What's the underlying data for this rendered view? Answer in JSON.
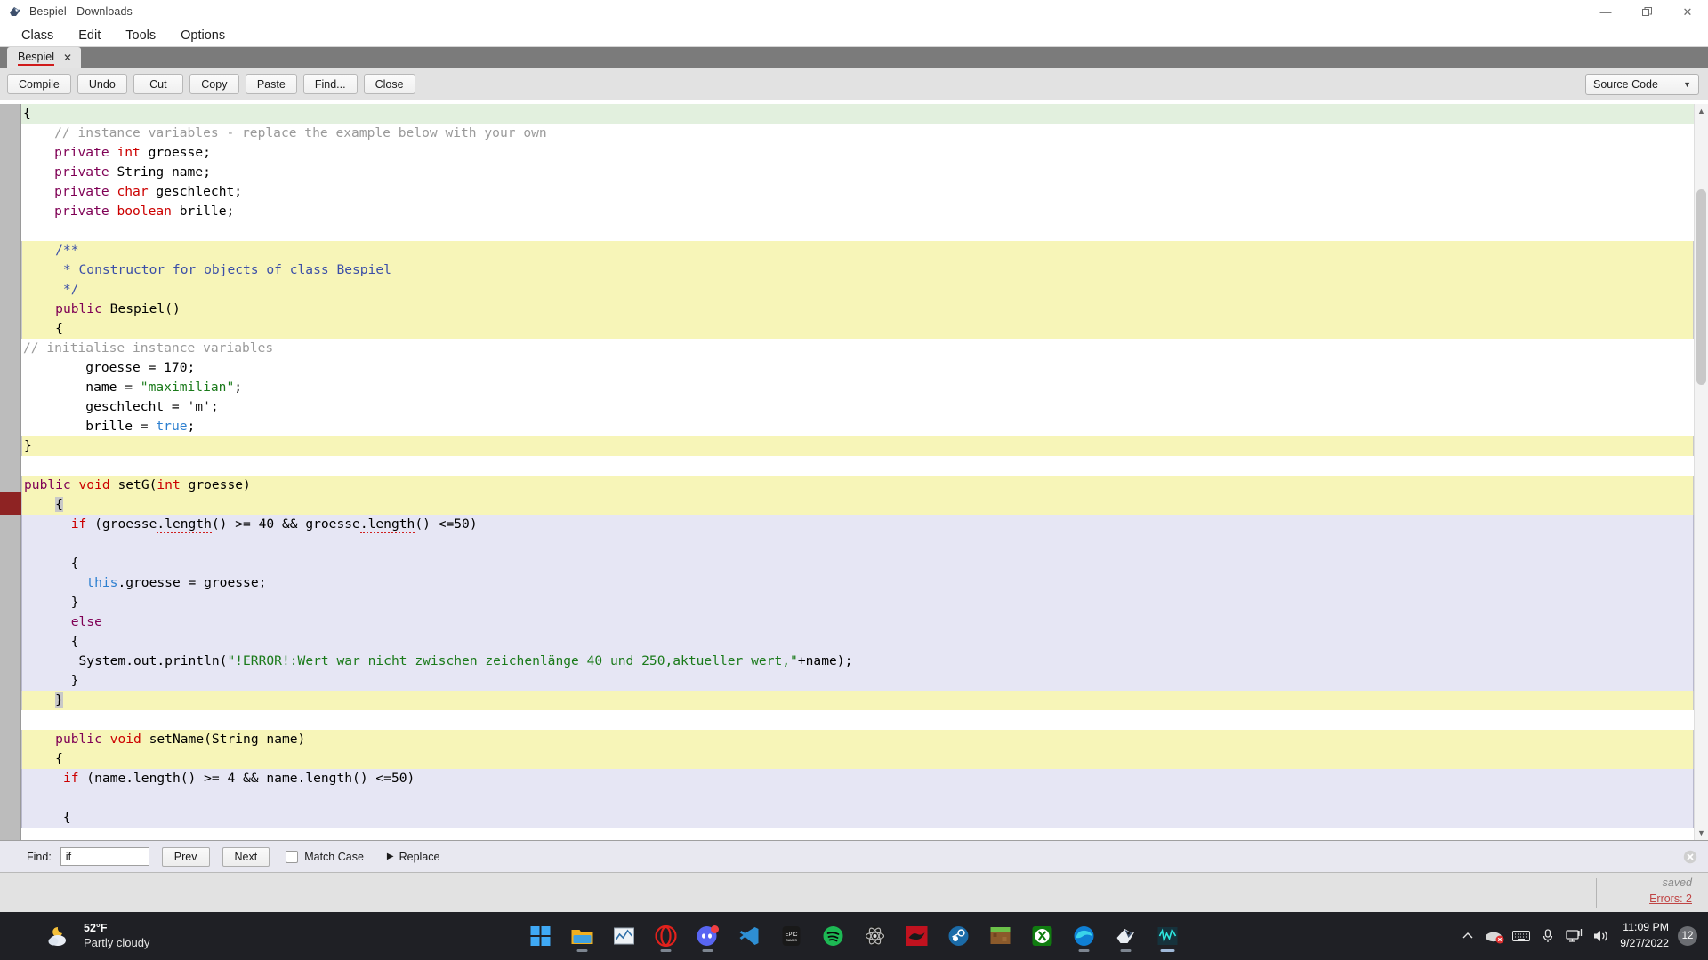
{
  "window": {
    "title": "Bespiel - Downloads",
    "app_icon": "bluej-bird-icon",
    "controls": {
      "minimize": "—",
      "maximize": "❐",
      "close": "✕"
    }
  },
  "menubar": {
    "items": [
      "Class",
      "Edit",
      "Tools",
      "Options"
    ]
  },
  "tabs": [
    {
      "label": "Bespiel",
      "close": "✕"
    }
  ],
  "toolbar": {
    "buttons": [
      "Compile",
      "Undo",
      "Cut",
      "Copy",
      "Paste",
      "Find...",
      "Close"
    ],
    "view_selector": {
      "value": "Source Code",
      "arrow": "▼"
    }
  },
  "editor": {
    "lines": [
      {
        "text": "{",
        "hl": "class",
        "indent": 0
      },
      {
        "text": "    // instance variables - replace the example below with your own",
        "hl": "plain"
      },
      {
        "text": "    private int groesse;",
        "hl": "plain"
      },
      {
        "text": "    private String name;",
        "hl": "plain"
      },
      {
        "text": "    private char geschlecht;",
        "hl": "plain"
      },
      {
        "text": "    private boolean brille;",
        "hl": "plain"
      },
      {
        "text": "",
        "hl": "plain"
      },
      {
        "text": "    /**",
        "hl": "method"
      },
      {
        "text": "     * Constructor for objects of class Bespiel",
        "hl": "method"
      },
      {
        "text": "     */",
        "hl": "method"
      },
      {
        "text": "    public Bespiel()",
        "hl": "method"
      },
      {
        "text": "    {",
        "hl": "method"
      },
      {
        "text": "// initialise instance variables",
        "hl": "plain"
      },
      {
        "text": "        groesse = 170;",
        "hl": "plain"
      },
      {
        "text": "        name = \"maximilian\";",
        "hl": "plain"
      },
      {
        "text": "        geschlecht = 'm';",
        "hl": "plain"
      },
      {
        "text": "        brille = true;",
        "hl": "plain"
      },
      {
        "text": "}",
        "hl": "method"
      },
      {
        "text": "",
        "hl": "plain"
      },
      {
        "text": "public void setG(int groesse)",
        "hl": "method"
      },
      {
        "text": "    {",
        "hl": "method"
      },
      {
        "text": "      if (groesse.length() >= 40 && groesse.length() <=50)",
        "hl": "if"
      },
      {
        "text": "",
        "hl": "if"
      },
      {
        "text": "      {",
        "hl": "if"
      },
      {
        "text": "        this.groesse = groesse;",
        "hl": "if"
      },
      {
        "text": "      }",
        "hl": "if"
      },
      {
        "text": "      else",
        "hl": "if"
      },
      {
        "text": "      {",
        "hl": "if"
      },
      {
        "text": "       System.out.println(\"!ERROR!:Wert war nicht zwischen zeichenlänge 40 und 250,aktueller wert,\"+name);",
        "hl": "if"
      },
      {
        "text": "      }",
        "hl": "if"
      },
      {
        "text": "    }",
        "hl": "method"
      },
      {
        "text": "",
        "hl": "plain"
      },
      {
        "text": "    public void setName(String name)",
        "hl": "method"
      },
      {
        "text": "    {",
        "hl": "method"
      },
      {
        "text": "     if (name.length() >= 4 && name.length() <=50)",
        "hl": "if"
      },
      {
        "text": "",
        "hl": "if"
      },
      {
        "text": "     {",
        "hl": "if"
      }
    ],
    "error_marker": "error-gutter-marker",
    "scroll_arrow_up": "▲",
    "scroll_arrow_down": "▼"
  },
  "findbar": {
    "label": "Find:",
    "input_value": "if",
    "input_placeholder": "",
    "prev": "Prev",
    "next": "Next",
    "match_case": "Match Case",
    "match_case_checked": false,
    "replace": "Replace",
    "replace_arrow": "▶",
    "close": "✕"
  },
  "statusbar": {
    "saved": "saved",
    "errors": "Errors: 2"
  },
  "taskbar": {
    "weather": {
      "temp": "52°F",
      "desc": "Partly cloudy",
      "icon": "moon-cloud-icon"
    },
    "apps": [
      {
        "name": "start-button",
        "icon": "windows-logo-icon"
      },
      {
        "name": "file-explorer",
        "icon": "folder-icon"
      },
      {
        "name": "charts-app",
        "icon": "chart-icon"
      },
      {
        "name": "opera-browser",
        "icon": "opera-icon"
      },
      {
        "name": "discord",
        "icon": "discord-icon",
        "badge": true
      },
      {
        "name": "vs-code",
        "icon": "vscode-icon"
      },
      {
        "name": "epic-games",
        "icon": "epic-games-icon"
      },
      {
        "name": "spotify",
        "icon": "spotify-icon"
      },
      {
        "name": "atom-editor",
        "icon": "atom-icon"
      },
      {
        "name": "red-app",
        "icon": "red-dragon-icon"
      },
      {
        "name": "steam",
        "icon": "steam-icon"
      },
      {
        "name": "minecraft",
        "icon": "minecraft-icon"
      },
      {
        "name": "xbox",
        "icon": "xbox-icon"
      },
      {
        "name": "microsoft-edge",
        "icon": "edge-icon",
        "running": true
      },
      {
        "name": "bluej",
        "icon": "bluej-bird-icon",
        "running": true
      },
      {
        "name": "audio-editor",
        "icon": "waveform-icon",
        "running": true,
        "active": true
      }
    ],
    "tray": {
      "chevron": "⌃",
      "icons": [
        "onedrive-error-icon",
        "keyboard-icon",
        "microphone-icon",
        "network-icon",
        "volume-icon"
      ],
      "time": "11:09 PM",
      "date": "9/27/2022",
      "notification_count": "12"
    }
  }
}
